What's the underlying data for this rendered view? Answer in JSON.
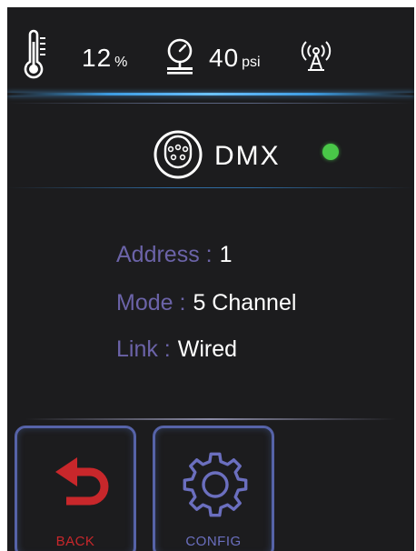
{
  "status_bar": {
    "humidity": {
      "value": "12",
      "unit": "%"
    },
    "pressure": {
      "value": "40",
      "unit": "psi"
    },
    "icons": [
      "thermometer-icon",
      "pressure-gauge-icon",
      "antenna-signal-icon"
    ]
  },
  "protocol": {
    "icon": "dmx-connector-icon",
    "title": "DMX",
    "status_color": "#49c748"
  },
  "info": {
    "address": {
      "label": "Address :",
      "value": "1"
    },
    "mode": {
      "label": "Mode :",
      "value": "5 Channel"
    },
    "link": {
      "label": "Link :",
      "value": "Wired"
    }
  },
  "buttons": {
    "back": {
      "label": "BACK",
      "icon": "back-arrow-icon",
      "color": "#c8272b"
    },
    "config": {
      "label": "CONFIG",
      "icon": "gear-icon",
      "color": "#6b6fbf"
    }
  },
  "colors": {
    "background": "#1c1c1e",
    "label": "#6b63a8",
    "accent_line": "#3d9be0",
    "button_border": "#5663a8"
  }
}
